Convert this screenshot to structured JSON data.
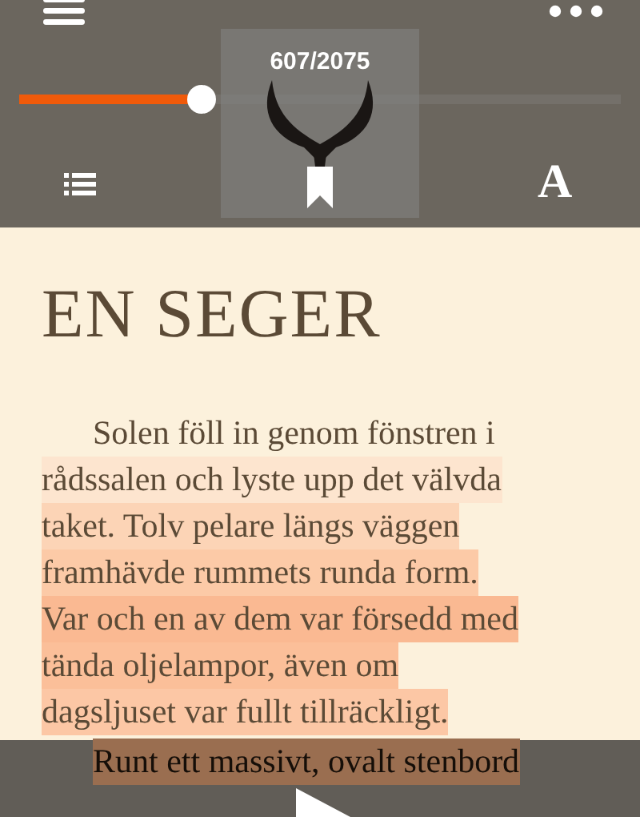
{
  "toolbar": {
    "progress": {
      "level": 0.29
    },
    "page_indicator": "607/2075",
    "font_button": "A"
  },
  "chapter_title": "EN SEGER",
  "paragraphs": [
    {
      "lines": [
        {
          "text": "Solen föll in genom fönstren i"
        },
        {
          "text": "rådssalen och lyste upp det välvda",
          "color": "#fde5cf"
        },
        {
          "text": "taket. Tolv pelare längs väggen",
          "color": "#fcd4b6"
        },
        {
          "text": "framhävde rummets runda form.",
          "color": "#fccaa7"
        },
        {
          "text": "Var och en av dem var försedd med",
          "color": "#fab992"
        },
        {
          "text": "tända oljelampor, även om",
          "color": "#fbbf99"
        },
        {
          "text": "dagsljuset var fullt tillräckligt.",
          "color": "#fcc7a5"
        }
      ]
    },
    {
      "lines": [
        {
          "text": "Runt ett massivt, ovalt stenbord",
          "color": "#9a6e50"
        }
      ]
    }
  ]
}
